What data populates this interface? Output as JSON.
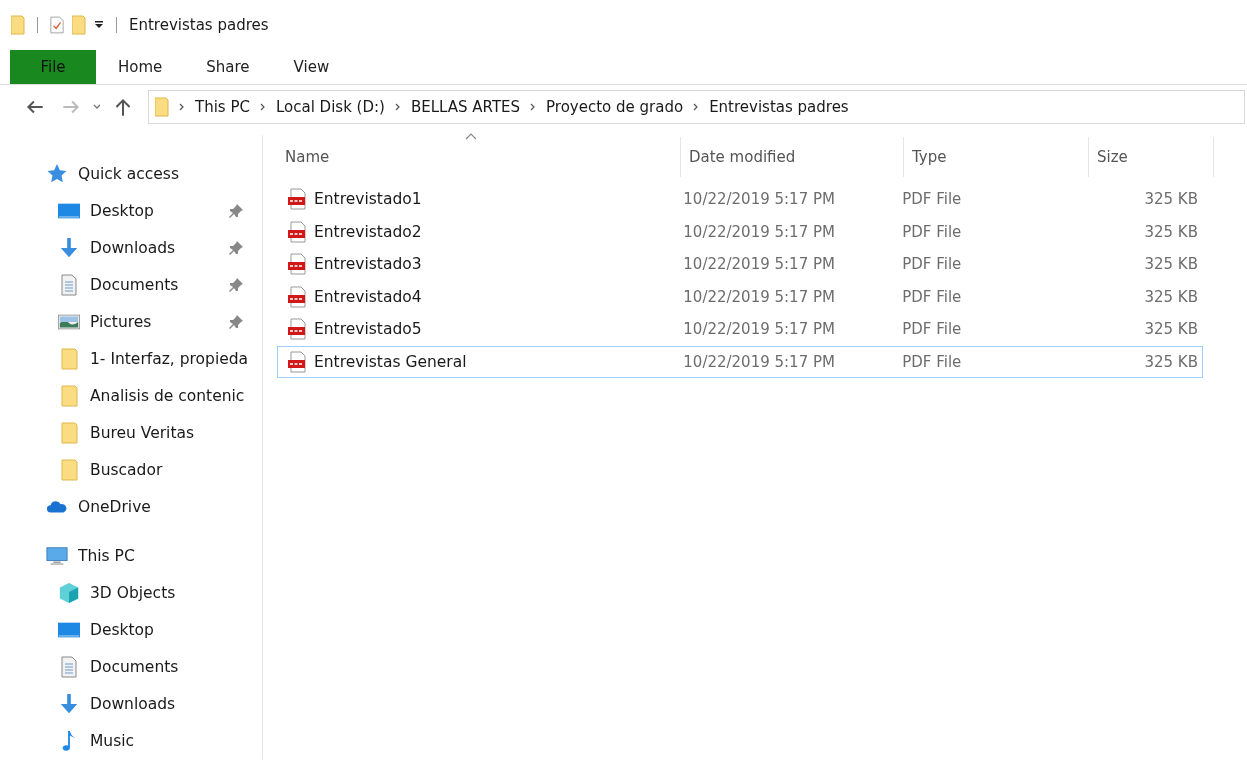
{
  "window": {
    "title": "Entrevistas padres"
  },
  "ribbon_tabs": [
    {
      "label": "File",
      "selected": true
    },
    {
      "label": "Home",
      "selected": false
    },
    {
      "label": "Share",
      "selected": false
    },
    {
      "label": "View",
      "selected": false
    }
  ],
  "breadcrumb": [
    "This PC",
    "Local Disk (D:)",
    "BELLAS ARTES",
    "Proyecto de grado",
    "Entrevistas padres"
  ],
  "sidebar": [
    {
      "label": "Quick access",
      "kind": "star",
      "children": [
        {
          "label": "Desktop",
          "kind": "desktop",
          "pinned": true
        },
        {
          "label": "Downloads",
          "kind": "downloads",
          "pinned": true
        },
        {
          "label": "Documents",
          "kind": "documents",
          "pinned": true
        },
        {
          "label": "Pictures",
          "kind": "pictures",
          "pinned": true
        },
        {
          "label": "1- Interfaz, propieda",
          "kind": "folder",
          "pinned": false
        },
        {
          "label": "Analisis de contenic",
          "kind": "folder",
          "pinned": false
        },
        {
          "label": "Bureu Veritas",
          "kind": "folder",
          "pinned": false
        },
        {
          "label": "Buscador",
          "kind": "folder",
          "pinned": false
        }
      ]
    },
    {
      "label": "OneDrive",
      "kind": "cloud"
    },
    {
      "label": "This PC",
      "kind": "pc",
      "children": [
        {
          "label": "3D Objects",
          "kind": "cube",
          "pinned": false
        },
        {
          "label": "Desktop",
          "kind": "desktop",
          "pinned": false
        },
        {
          "label": "Documents",
          "kind": "documents",
          "pinned": false
        },
        {
          "label": "Downloads",
          "kind": "downloads",
          "pinned": false
        },
        {
          "label": "Music",
          "kind": "music",
          "pinned": false
        }
      ]
    }
  ],
  "table": {
    "columns": [
      "Name",
      "Date modified",
      "Type",
      "Size"
    ],
    "rows": [
      {
        "name": "Entrevistado1",
        "date": "10/22/2019 5:17 PM",
        "type": "PDF File",
        "size": "325 KB",
        "focused": false
      },
      {
        "name": "Entrevistado2",
        "date": "10/22/2019 5:17 PM",
        "type": "PDF File",
        "size": "325 KB",
        "focused": false
      },
      {
        "name": "Entrevistado3",
        "date": "10/22/2019 5:17 PM",
        "type": "PDF File",
        "size": "325 KB",
        "focused": false
      },
      {
        "name": "Entrevistado4",
        "date": "10/22/2019 5:17 PM",
        "type": "PDF File",
        "size": "325 KB",
        "focused": false
      },
      {
        "name": "Entrevistado5",
        "date": "10/22/2019 5:17 PM",
        "type": "PDF File",
        "size": "325 KB",
        "focused": false
      },
      {
        "name": "Entrevistas General",
        "date": "10/22/2019 5:17 PM",
        "type": "PDF File",
        "size": "325 KB",
        "focused": true
      }
    ]
  }
}
